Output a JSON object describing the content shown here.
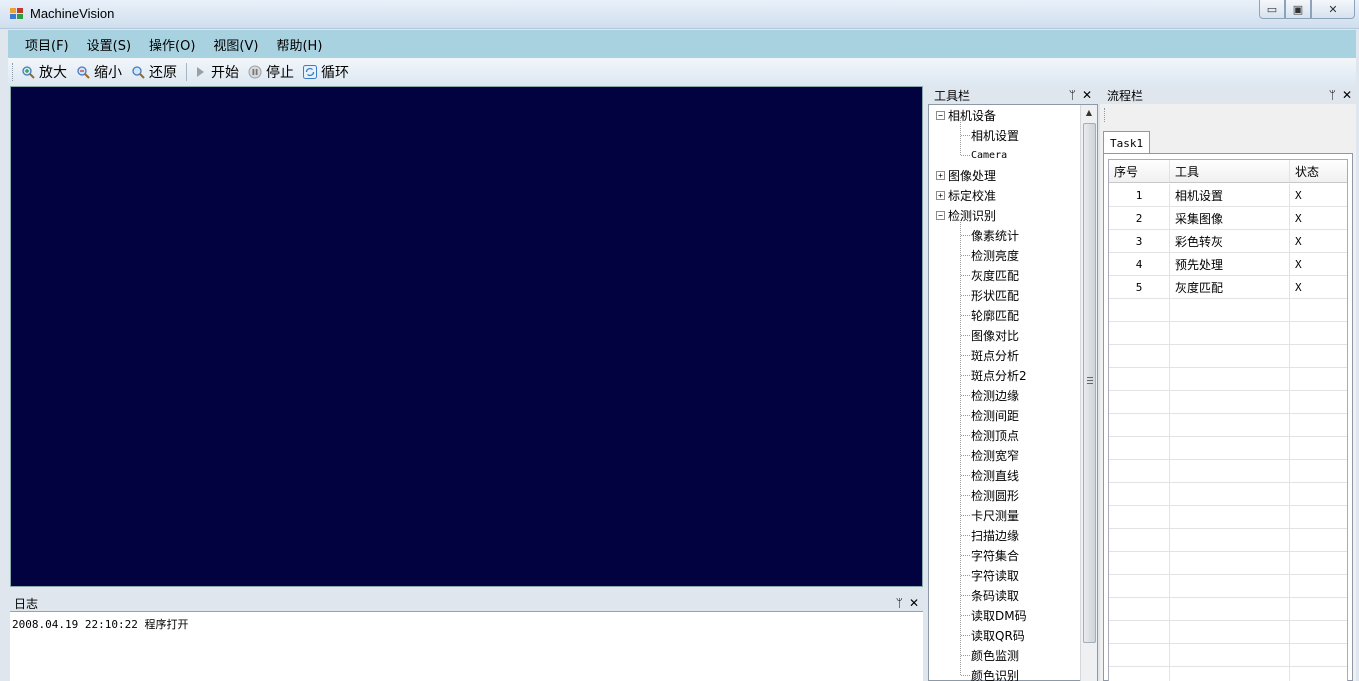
{
  "window": {
    "title": "MachineVision",
    "min_symbol": "▭",
    "max_symbol": "▣",
    "close_symbol": "✕"
  },
  "menu": [
    "项目(F)",
    "设置(S)",
    "操作(O)",
    "视图(V)",
    "帮助(H)"
  ],
  "toolbar": {
    "zoom_in": "放大",
    "zoom_out": "缩小",
    "restore": "还原",
    "start": "开始",
    "stop": "停止",
    "loop": "循环"
  },
  "log": {
    "title": "日志",
    "entry": "2008.04.19 22:10:22 程序打开"
  },
  "tools": {
    "title": "工具栏",
    "groups": [
      {
        "label": "相机设备",
        "expanded": true,
        "children": [
          "相机设置",
          "Camera"
        ]
      },
      {
        "label": "图像处理",
        "expanded": false,
        "children": []
      },
      {
        "label": "标定校准",
        "expanded": false,
        "children": []
      },
      {
        "label": "检测识别",
        "expanded": true,
        "children": [
          "像素统计",
          "检测亮度",
          "灰度匹配",
          "形状匹配",
          "轮廓匹配",
          "图像对比",
          "斑点分析",
          "斑点分析2",
          "检测边缘",
          "检测间距",
          "检测顶点",
          "检测宽窄",
          "检测直线",
          "检测圆形",
          "卡尺测量",
          "扫描边缘",
          "字符集合",
          "字符读取",
          "条码读取",
          "读取DM码",
          "读取QR码",
          "颜色监测",
          "颜色识别"
        ]
      }
    ]
  },
  "flow": {
    "title": "流程栏",
    "tab": "Task1",
    "columns": [
      "序号",
      "工具",
      "状态"
    ],
    "rows": [
      {
        "no": "1",
        "tool": "相机设置",
        "status": "X"
      },
      {
        "no": "2",
        "tool": "采集图像",
        "status": "X"
      },
      {
        "no": "3",
        "tool": "彩色转灰",
        "status": "X"
      },
      {
        "no": "4",
        "tool": "预先处理",
        "status": "X"
      },
      {
        "no": "5",
        "tool": "灰度匹配",
        "status": "X"
      }
    ]
  },
  "panel_controls": {
    "pin": "ᛘ",
    "close": "✕"
  }
}
